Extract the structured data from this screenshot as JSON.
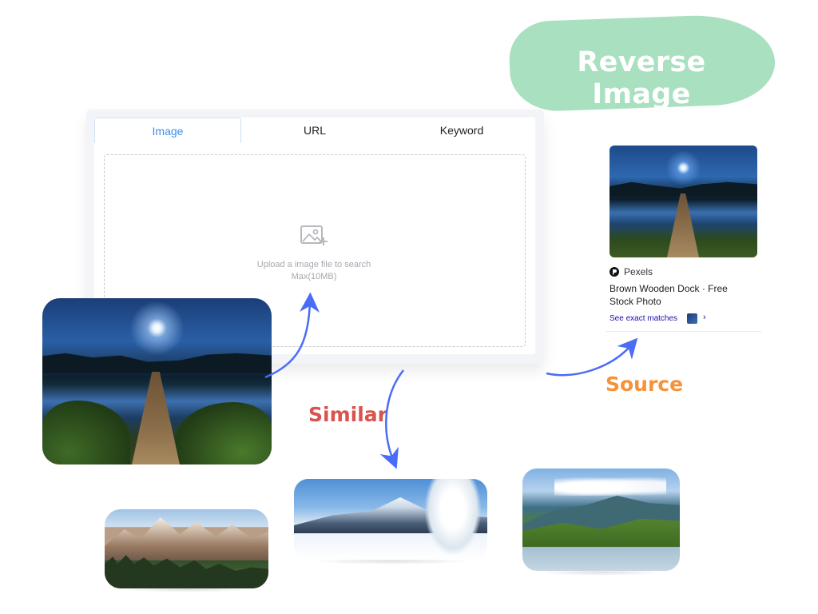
{
  "header": {
    "title": "Reverse Image"
  },
  "search_panel": {
    "tabs": [
      {
        "label": "Image",
        "active": true
      },
      {
        "label": "URL",
        "active": false
      },
      {
        "label": "Keyword",
        "active": false
      }
    ],
    "upload": {
      "icon": "image-add-icon",
      "line1": "Upload a image file to search",
      "line2": "Max(10MB)"
    }
  },
  "source_result": {
    "site_icon": "pexels-logo-icon",
    "site": "Pexels",
    "title": "Brown Wooden Dock · Free Stock Photo",
    "link_label": "See exact matches",
    "link_chevron": "›"
  },
  "labels": {
    "similar": "Similar",
    "source": "Source"
  },
  "colors": {
    "title_blob": "#a8e0c0",
    "active_tab": "#3a8ee6",
    "similar_label": "#d9534f",
    "source_label": "#f5923a",
    "arrows": "#4a6cf7"
  }
}
